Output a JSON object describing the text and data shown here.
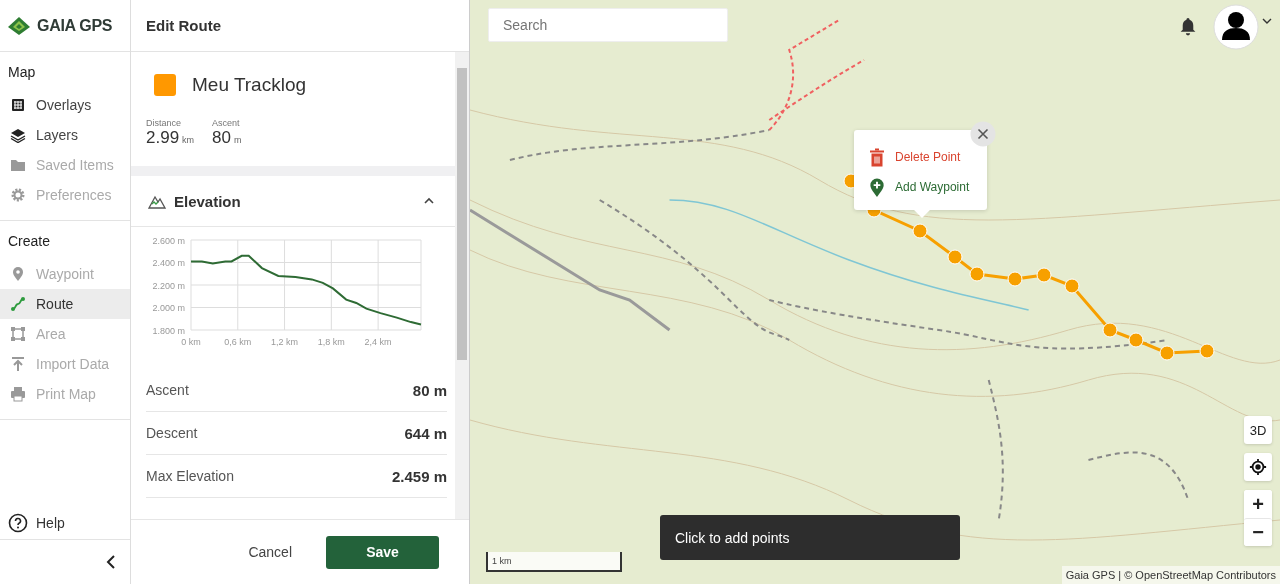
{
  "brand": {
    "name": "GAIA GPS"
  },
  "sidebar": {
    "sections": [
      {
        "title": "Map",
        "items": [
          {
            "label": "Overlays",
            "selected": false,
            "disabled": false
          },
          {
            "label": "Layers",
            "selected": false,
            "disabled": false
          },
          {
            "label": "Saved Items",
            "selected": false,
            "disabled": true
          },
          {
            "label": "Preferences",
            "selected": false,
            "disabled": true
          }
        ]
      },
      {
        "title": "Create",
        "items": [
          {
            "label": "Waypoint",
            "selected": false,
            "disabled": true
          },
          {
            "label": "Route",
            "selected": true,
            "disabled": false
          },
          {
            "label": "Area",
            "selected": false,
            "disabled": true
          },
          {
            "label": "Import Data",
            "selected": false,
            "disabled": true
          },
          {
            "label": "Print Map",
            "selected": false,
            "disabled": true
          }
        ]
      }
    ],
    "help": "Help"
  },
  "panel": {
    "title": "Edit Route",
    "route_name": "Meu Tracklog",
    "summary": [
      {
        "label": "Distance",
        "value": "2.99",
        "unit": "km"
      },
      {
        "label": "Ascent",
        "value": "80",
        "unit": "m"
      }
    ],
    "elevation": {
      "title": "Elevation",
      "expanded": true,
      "chart_data": {
        "type": "line",
        "x": [
          0,
          0.14,
          0.28,
          0.44,
          0.52,
          0.65,
          0.74,
          0.91,
          1.12,
          1.34,
          1.55,
          1.69,
          1.82,
          1.99,
          2.12,
          2.25,
          2.43,
          2.64,
          2.82,
          2.95
        ],
        "series": [
          {
            "color": "#2e6b34",
            "values": [
              2410,
              2410,
              2390,
              2410,
              2410,
              2460,
              2460,
              2350,
              2280,
              2270,
              2250,
              2220,
              2170,
              2070,
              2040,
              1990,
              1950,
              1910,
              1870,
              1850
            ]
          }
        ],
        "grid": true,
        "xlim": [
          0,
          2.95
        ],
        "ylim": [
          1800,
          2600
        ],
        "xticks": [
          {
            "value": 0,
            "label": "0 km"
          },
          {
            "value": 0.6,
            "label": "0,6 km"
          },
          {
            "value": 1.2,
            "label": "1,2 km"
          },
          {
            "value": 1.8,
            "label": "1,8 km"
          },
          {
            "value": 2.4,
            "label": "2,4 km"
          }
        ],
        "yticks": [
          {
            "value": 1800,
            "label": "1.800 m"
          },
          {
            "value": 2000,
            "label": "2.000 m"
          },
          {
            "value": 2200,
            "label": "2.200 m"
          },
          {
            "value": 2400,
            "label": "2.400 m"
          },
          {
            "value": 2600,
            "label": "2.600 m"
          }
        ]
      }
    },
    "stats": [
      {
        "label": "Ascent",
        "value": "80 m"
      },
      {
        "label": "Descent",
        "value": "644 m"
      },
      {
        "label": "Max Elevation",
        "value": "2.459 m"
      }
    ],
    "buttons": {
      "cancel": "Cancel",
      "save": "Save"
    }
  },
  "map": {
    "search": {
      "placeholder": "Search"
    },
    "popup": {
      "items": [
        {
          "kind": "delete",
          "label": "Delete Point"
        },
        {
          "kind": "waypoint",
          "label": "Add Waypoint"
        }
      ]
    },
    "toast": "Click to add points",
    "scale": "1 km",
    "controls": {
      "three_d": "3D",
      "zoom_in": "+",
      "zoom_out": "−"
    },
    "attribution": "Gaia GPS | © OpenStreetMap Contributors"
  }
}
